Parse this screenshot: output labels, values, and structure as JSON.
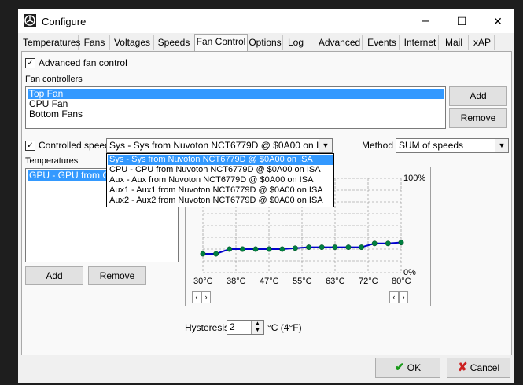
{
  "window": {
    "title": "Configure",
    "minimize": "–",
    "maximize": "☐",
    "close": "✕"
  },
  "tabs": [
    {
      "label": "Temperatures"
    },
    {
      "label": "Fans"
    },
    {
      "label": "Voltages"
    },
    {
      "label": "Speeds"
    },
    {
      "label": "Fan Control",
      "active": true
    },
    {
      "label": "Options"
    },
    {
      "label": "Log"
    },
    {
      "label": "Advanced"
    },
    {
      "label": "Events"
    },
    {
      "label": "Internet"
    },
    {
      "label": "Mail"
    },
    {
      "label": "xAP"
    }
  ],
  "advanced": {
    "checkbox_label": "Advanced fan control",
    "checked": true
  },
  "fan_controllers": {
    "label": "Fan controllers",
    "items": [
      "Top Fan",
      "CPU Fan",
      "Bottom Fans"
    ],
    "selected_index": 0,
    "add_label": "Add",
    "remove_label": "Remove"
  },
  "controlled_speed": {
    "checkbox_label": "Controlled speed",
    "checked": true,
    "value": "Sys - Sys from Nuvoton NCT6779D @ $0A00 on ISA",
    "options": [
      "Sys - Sys from Nuvoton NCT6779D @ $0A00 on ISA",
      "CPU - CPU from Nuvoton NCT6779D @ $0A00 on ISA",
      "Aux - Aux from Nuvoton NCT6779D @ $0A00 on ISA",
      "Aux1 - Aux1 from Nuvoton NCT6779D @ $0A00 on ISA",
      "Aux2 - Aux2 from Nuvoton NCT6779D @ $0A00 on ISA"
    ],
    "selected_index": 0
  },
  "method": {
    "label": "Method",
    "value": "SUM of speeds"
  },
  "temperatures": {
    "label": "Temperatures",
    "items": [
      "GPU - GPU from GeForce"
    ],
    "add_label": "Add",
    "remove_label": "Remove"
  },
  "chart_data": {
    "type": "line",
    "x_ticks": [
      "30°C",
      "38°C",
      "47°C",
      "55°C",
      "63°C",
      "72°C",
      "80°C"
    ],
    "y_ticks": [
      "100%",
      "0%"
    ],
    "xlim": [
      30,
      80
    ],
    "ylim": [
      0,
      100
    ],
    "series": [
      {
        "color": "#0000cc",
        "point_color": "#008040",
        "x": [
          30,
          33.3,
          36.7,
          40,
          43.3,
          46.7,
          50,
          53.3,
          56.7,
          60,
          63.3,
          66.7,
          70,
          73.3,
          76.7,
          80
        ],
        "y": [
          20,
          20,
          25,
          25,
          25,
          25,
          25,
          26,
          27,
          27,
          27,
          27,
          27,
          31,
          31,
          32
        ]
      }
    ],
    "grid": true
  },
  "hysteresis": {
    "label": "Hysteresis",
    "value": "2",
    "unit": "°C (4°F)"
  },
  "footer": {
    "ok_label": "OK",
    "cancel_label": "Cancel",
    "ok_color": "#1a9a1a",
    "cancel_color": "#cc2020"
  }
}
